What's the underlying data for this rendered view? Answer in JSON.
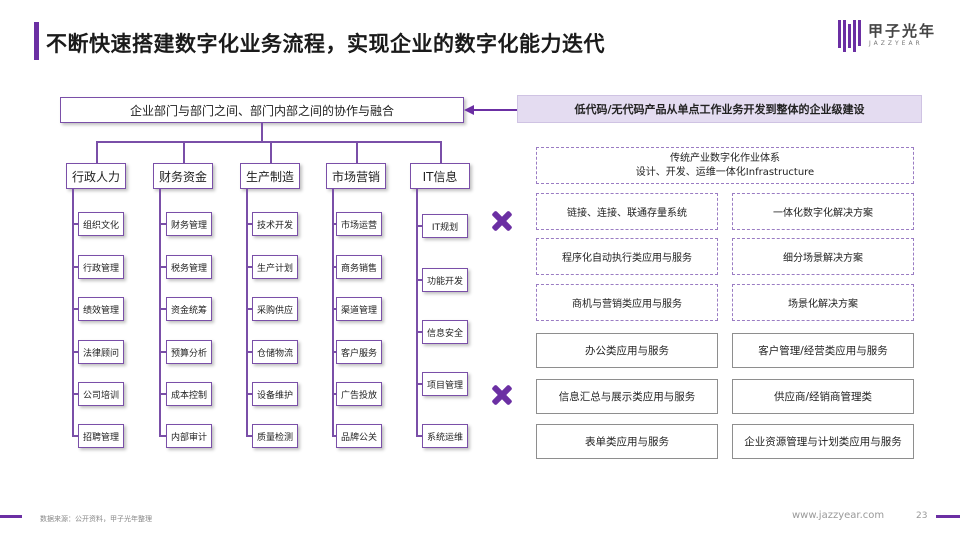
{
  "title": "不断快速搭建数字化业务流程，实现企业的数字化能力迭代",
  "logo": {
    "name": "甲子光年",
    "sub": "JAZZYEAR"
  },
  "top_box": "企业部门与部门之间、部门内部之间的协作与融合",
  "right_banner": "低代码/无代码产品从单点工作业务开发到整体的企业级建设",
  "departments": [
    {
      "label": "行政人力",
      "items": [
        "组织文化",
        "行政管理",
        "绩效管理",
        "法律顾问",
        "公司培训",
        "招聘管理"
      ]
    },
    {
      "label": "财务资金",
      "items": [
        "财务管理",
        "税务管理",
        "资金统筹",
        "预算分析",
        "成本控制",
        "内部审计"
      ]
    },
    {
      "label": "生产制造",
      "items": [
        "技术开发",
        "生产计划",
        "采购供应",
        "仓储物流",
        "设备维护",
        "质量检测"
      ]
    },
    {
      "label": "市场营销",
      "items": [
        "市场运营",
        "商务销售",
        "渠道管理",
        "客户服务",
        "广告投放",
        "品牌公关"
      ]
    },
    {
      "label": "IT信息",
      "items": [
        "IT规划",
        "功能开发",
        "信息安全",
        "项目管理",
        "系统运维"
      ]
    }
  ],
  "traditional": {
    "line1": "传统产业数字化作业体系",
    "line2": "设计、开发、运维一体化Infrastructure"
  },
  "dashed_boxes": [
    "链接、连接、联通存量系统",
    "一体化数字化解决方案",
    "程序化自动执行类应用与服务",
    "细分场景解决方案",
    "商机与营销类应用与服务",
    "场景化解决方案"
  ],
  "solid_boxes": [
    "办公类应用与服务",
    "客户管理/经营类应用与服务",
    "信息汇总与展示类应用与服务",
    "供应商/经销商管理类",
    "表单类应用与服务",
    "企业资源管理与计划类应用与服务"
  ],
  "footer": {
    "source": "数据来源：公开资料，甲子光年整理",
    "url": "www.jazzyear.com",
    "page": "23"
  },
  "colors": {
    "accent": "#6b2fa3",
    "banner_bg": "#e4dcf1"
  }
}
